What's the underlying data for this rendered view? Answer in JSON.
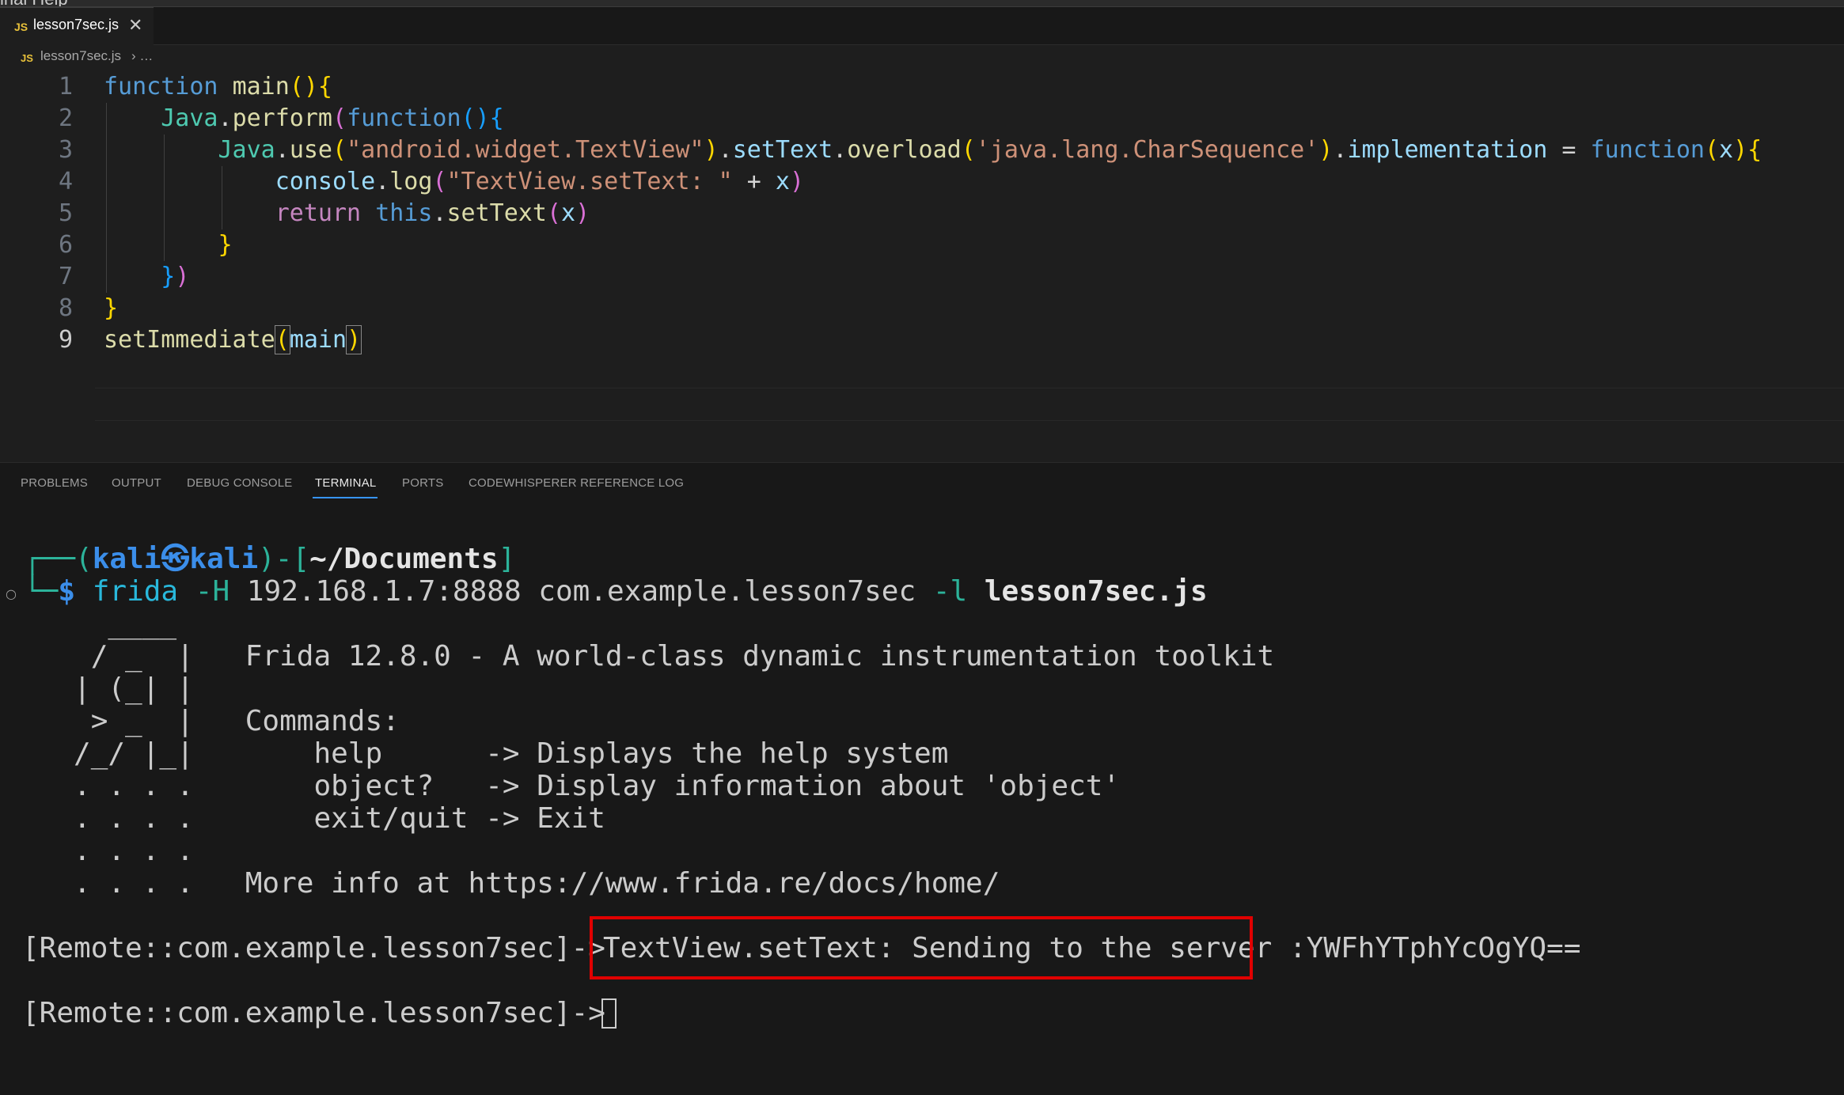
{
  "menubar": {
    "text": "inal Help"
  },
  "tab": {
    "icon": "JS",
    "label": "lesson7sec.js",
    "close": "✕"
  },
  "breadcrumb": {
    "icon": "JS",
    "file": "lesson7sec.js",
    "sep": "› …"
  },
  "editor": {
    "line_numbers": [
      "1",
      "2",
      "3",
      "4",
      "5",
      "6",
      "7",
      "8",
      "9"
    ],
    "active_line": 9
  },
  "panel": {
    "tabs": [
      "PROBLEMS",
      "OUTPUT",
      "DEBUG CONSOLE",
      "TERMINAL",
      "PORTS",
      "CODEWHISPERER REFERENCE LOG"
    ],
    "active_tab": "TERMINAL"
  },
  "terminal": {
    "prompt_corner_top": "┌──(",
    "prompt_user": "kali",
    "prompt_host": "kali",
    "prompt_sep": ")-[",
    "prompt_dir": "~/Documents",
    "prompt_close": "]",
    "prompt_corner_bottom": "└─",
    "prompt_dollar": "$",
    "command_name": "frida",
    "command_flag_h": "-H",
    "command_args": "192.168.1.7:8888 com.example.lesson7sec",
    "command_flag_l": "-l",
    "command_file": "lesson7sec.js",
    "banner": [
      "     ____",
      "    / _  |   Frida 12.8.0 - A world-class dynamic instrumentation toolkit",
      "   | (_| |",
      "    > _  |   Commands:",
      "   /_/ |_|       help      -> Displays the help system",
      "   . . . .       object?   -> Display information about 'object'",
      "   . . . .       exit/quit -> Exit",
      "   . . . .",
      "   . . . .   More info at https://www.frida.re/docs/home/"
    ],
    "remote_prompt_1": "[Remote::com.example.lesson7sec]->",
    "output_line": "TextView.setText: Sending to the server :YWFhYTphYcOgYQ==",
    "remote_prompt_2": "[Remote::com.example.lesson7sec]->"
  }
}
